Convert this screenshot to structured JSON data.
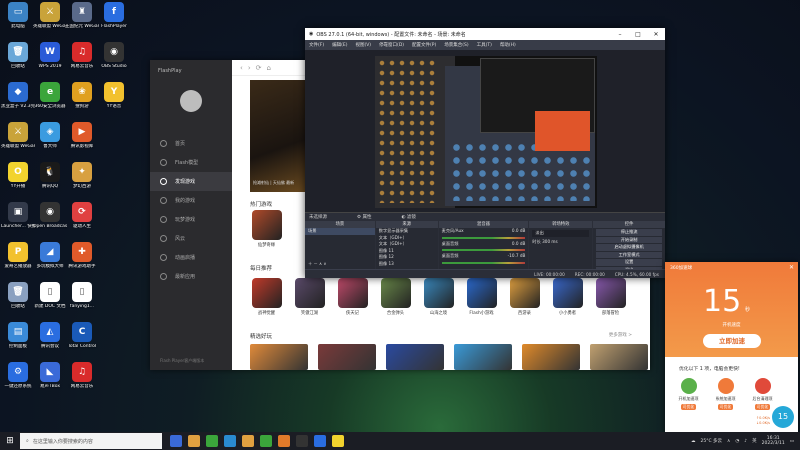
{
  "desktop_icons": [
    {
      "label": "此电脑",
      "color": "#3b82c4",
      "glyph": "▭"
    },
    {
      "label": "英雄联盟 WeGame版",
      "color": "#c9a33a",
      "glyph": "⚔"
    },
    {
      "label": "王国纪元 WeGame版",
      "color": "#5a6a8a",
      "glyph": "♜"
    },
    {
      "label": "FlashPlayer",
      "color": "#2a6de0",
      "glyph": "f"
    },
    {
      "label": "回收站",
      "color": "#6aa7d8",
      "glyph": "🗑"
    },
    {
      "label": "WPS 2019",
      "color": "#2a5bd7",
      "glyph": "W"
    },
    {
      "label": "网易云音乐",
      "color": "#d92b2b",
      "glyph": "♫"
    },
    {
      "label": "OBS Studio",
      "color": "#333333",
      "glyph": "◉"
    },
    {
      "label": "黑亚盒子 V2.3完整",
      "color": "#2b6bd1",
      "glyph": "◆"
    },
    {
      "label": "360安全浏览器",
      "color": "#3ba53b",
      "glyph": "e"
    },
    {
      "label": "搜狗游",
      "color": "#e0a020",
      "glyph": "❀"
    },
    {
      "label": "YY语音",
      "color": "#f2c12e",
      "glyph": "Y"
    },
    {
      "label": "英雄联盟 WeGame版",
      "color": "#c9a33a",
      "glyph": "⚔"
    },
    {
      "label": "鲁大师",
      "color": "#3a9be0",
      "glyph": "◈"
    },
    {
      "label": "腾讯影视库",
      "color": "#e05a2a",
      "glyph": "▶"
    },
    {
      "label": "",
      "color": "transparent",
      "glyph": ""
    },
    {
      "label": "YY开播",
      "color": "#f2d32e",
      "glyph": "O"
    },
    {
      "label": "腾讯QQ",
      "color": "#1a1a1a",
      "glyph": "🐧"
    },
    {
      "label": "梦幻西游",
      "color": "#d8a040",
      "glyph": "✦"
    },
    {
      "label": "",
      "color": "transparent",
      "glyph": ""
    },
    {
      "label": "Launcher... 快捷方式",
      "color": "#333a4a",
      "glyph": "▣"
    },
    {
      "label": "Open Broadcast...",
      "color": "#333333",
      "glyph": "◉"
    },
    {
      "label": "驱动人生",
      "color": "#e04040",
      "glyph": "⟳"
    },
    {
      "label": "",
      "color": "transparent",
      "glyph": ""
    },
    {
      "label": "爱奇艺播放器",
      "color": "#f2c12e",
      "glyph": "P"
    },
    {
      "label": "多玩模拟大师",
      "color": "#3a7ad8",
      "glyph": "◢"
    },
    {
      "label": "腾讯游戏助手",
      "color": "#e05a2a",
      "glyph": "✚"
    },
    {
      "label": "",
      "color": "transparent",
      "glyph": ""
    },
    {
      "label": "回收站",
      "color": "#8aa0c0",
      "glyph": "🗑"
    },
    {
      "label": "新建 DOC 文档",
      "color": "#ffffff",
      "glyph": "▯"
    },
    {
      "label": "fanying1...",
      "color": "#ffffff",
      "glyph": "▯"
    },
    {
      "label": "",
      "color": "transparent",
      "glyph": ""
    },
    {
      "label": "控制面板",
      "color": "#3a8ad8",
      "glyph": "▤"
    },
    {
      "label": "腾讯会议",
      "color": "#2a6de0",
      "glyph": "◭"
    },
    {
      "label": "Total Control",
      "color": "#1a5ab8",
      "glyph": "C"
    },
    {
      "label": "",
      "color": "transparent",
      "glyph": ""
    },
    {
      "label": "一键还原系统",
      "color": "#2a6de0",
      "glyph": "⚙"
    },
    {
      "label": "易声TBox",
      "color": "#3a6ad8",
      "glyph": "◣"
    },
    {
      "label": "网易云音乐",
      "color": "#d92b2b",
      "glyph": "♫"
    }
  ],
  "flashplayer": {
    "brand": "FlashPlay",
    "nav": [
      {
        "label": "首页",
        "active": false
      },
      {
        "label": "Flash模型",
        "active": false
      },
      {
        "label": "发现游戏",
        "active": true
      },
      {
        "label": "我的游戏",
        "active": false
      },
      {
        "label": "玩梦游戏",
        "active": false
      },
      {
        "label": "风云",
        "active": false
      },
      {
        "label": "动画启播",
        "active": false
      },
      {
        "label": "最新应用",
        "active": false
      }
    ],
    "footer": "Flash Player客户端版本",
    "banner_caption": "抢滩射仙 | 天仙佛 最新",
    "hot_title": "热门游戏",
    "hot_games": [
      {
        "name": "仙梦奇缘",
        "color": "#b04a2a"
      }
    ],
    "daily_title": "每日推荐",
    "daily_games": [
      {
        "name": "战神觉醒",
        "color": "#c03a2a"
      },
      {
        "name": "笑傲江湖",
        "color": "#5a4a6a"
      },
      {
        "name": "侠天记",
        "color": "#c04a6a"
      },
      {
        "name": "合金弹头",
        "color": "#6a8a4a"
      },
      {
        "name": "山海之境",
        "color": "#3a8ac0"
      },
      {
        "name": "Flash小游戏",
        "color": "#2a6ad0"
      },
      {
        "name": "西游录",
        "color": "#e0a040"
      },
      {
        "name": "小小勇者",
        "color": "#3a6ad0"
      },
      {
        "name": "部落冒险",
        "color": "#8a5ab0"
      }
    ],
    "more_label": "更多游戏 >",
    "select_title": "精选好玩",
    "select_cards": [
      "#e08a3a",
      "#7a3a3a",
      "#2a4aa0",
      "#3a9ad8",
      "#e08a2a",
      "#c0a070"
    ]
  },
  "obs": {
    "title": "OBS 27.0.1 (64-bit, windows) - 配置文件: 未命名 - 场景: 未命名",
    "menu": [
      "文件(F)",
      "编辑(E)",
      "视图(V)",
      "停靠窗口(D)",
      "配置文件(P)",
      "场景集合(S)",
      "工具(T)",
      "帮助(H)"
    ],
    "source_bar": [
      "未选择源",
      "属性",
      "滤镜"
    ],
    "docks": {
      "scenes": {
        "header": "场景",
        "items": [
          "场景"
        ]
      },
      "sources": {
        "header": "来源",
        "items": [
          "数字显示器采集",
          "文本（GDI+）",
          "文本（GDI+）",
          "图像 11",
          "图像 12",
          "图像 13"
        ]
      },
      "mixer": {
        "header": "混音器",
        "items": [
          "麦克风/Aux",
          "桌面音频",
          "桌面音频"
        ],
        "levels": [
          "0.0 dB",
          "0.0 dB",
          "-10.7 dB"
        ]
      },
      "transitions": {
        "header": "转场特效",
        "fade": "淡出",
        "duration_label": "时长",
        "duration": "300 ms"
      },
      "controls": {
        "header": "控件",
        "buttons": [
          "停止推流",
          "开始录制",
          "启动虚拟摄像机",
          "工作室模式",
          "设置",
          "退出"
        ]
      }
    },
    "status": [
      "LIVE: 00:00:00",
      "REC: 00:00:00",
      "CPU: 4.5%, 60.00 fps"
    ]
  },
  "popup": {
    "title": "360加速球",
    "count": "15",
    "unit": "秒",
    "subtitle": "开机速度",
    "action_button": "立即加速",
    "desc": "优化以下 1 项，电脑会更快!",
    "actions": [
      {
        "label": "开机加速项",
        "tag": "可优化",
        "color": "#5ab04a"
      },
      {
        "label": "系统加速项",
        "tag": "可优化",
        "color": "#f07a3a"
      },
      {
        "label": "后台清理项",
        "tag": "可优化",
        "color": "#e04a3a"
      }
    ],
    "badge": "15",
    "speed_up": "0.0K/s",
    "speed_down": "0.0K/s"
  },
  "taskbar": {
    "search_placeholder": "在这里输入你要搜索的内容",
    "apps": [
      "#3a6ad8",
      "#e0a040",
      "#3ba53b",
      "#2a8ad0",
      "#e0a040",
      "#3ba53b",
      "#e07a2a",
      "#333333",
      "#2a6de0",
      "#f2d32e"
    ],
    "weather": "25°C 多云",
    "lang": "英",
    "time": "16:31",
    "date": "2022/3/11"
  }
}
